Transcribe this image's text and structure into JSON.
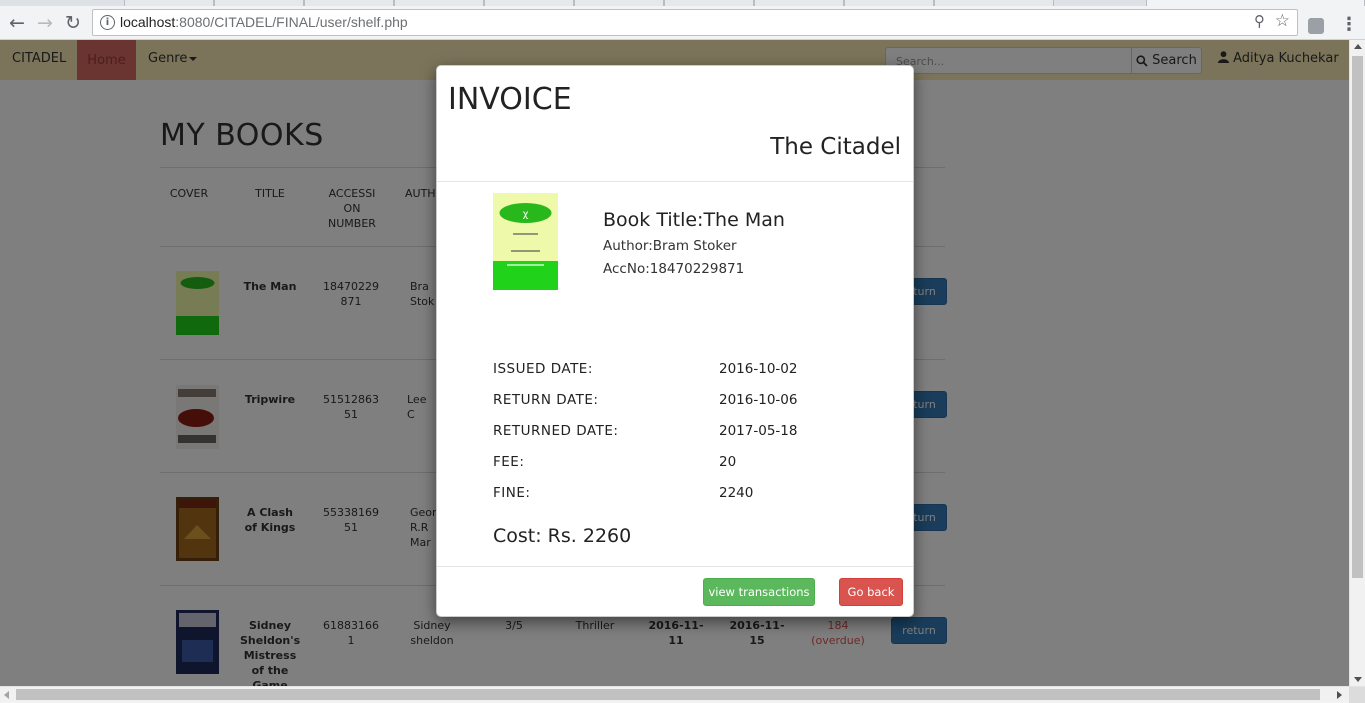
{
  "browser": {
    "url_host": "localhost",
    "url_rest": ":8080/CITADEL/FINAL/user/shelf.php"
  },
  "navbar": {
    "brand": "CITADEL",
    "home": "Home",
    "genre": "Genre",
    "search_placeholder": "Search...",
    "search_button": "Search",
    "user_name": "Aditya Kuchekar"
  },
  "page": {
    "title": "MY BOOKS",
    "headers": [
      "COVER",
      "TITLE",
      "ACCESSI ON NUMBER",
      "AUTH"
    ],
    "rows": [
      {
        "title": "The Man",
        "accession": "18470229 871",
        "author": "Bra Stok",
        "return": "return"
      },
      {
        "title": "Tripwire",
        "accession": "51512863 51",
        "author": "Lee C",
        "return": "return"
      },
      {
        "title": "A Clash of Kings",
        "accession": "55338169 51",
        "author": "Geor R.R Mar",
        "return": "return"
      },
      {
        "title": "Sidney Sheldon's Mistress of the Game",
        "accession": "61883166 1",
        "author": "Sidney sheldon",
        "rating": "3/5",
        "genre": "Thriller",
        "issued": "2016-11-11",
        "due": "2016-11-15",
        "fine": "184",
        "fine_note": "(overdue)",
        "return": "return"
      }
    ]
  },
  "modal": {
    "title": "INVOICE",
    "subtitle": "The Citadel",
    "book_title": "Book Title:The Man",
    "author": "Author:Bram Stoker",
    "acc_no": "AccNo:18470229871",
    "labels": [
      "ISSUED DATE:",
      "RETURN DATE:",
      "RETURNED DATE:",
      "FEE:",
      "FINE:"
    ],
    "values": [
      "2016-10-02",
      "2016-10-06",
      "2017-05-18",
      "20",
      "2240"
    ],
    "cost": "Cost: Rs. 2260",
    "view_transactions": "view transactions",
    "go_back": "Go back"
  },
  "colors": {
    "navbar_bg": "#f7e9b5",
    "home_active": "#d46b62",
    "primary": "#337ab7",
    "success": "#5cb85c",
    "danger": "#d9534f"
  }
}
